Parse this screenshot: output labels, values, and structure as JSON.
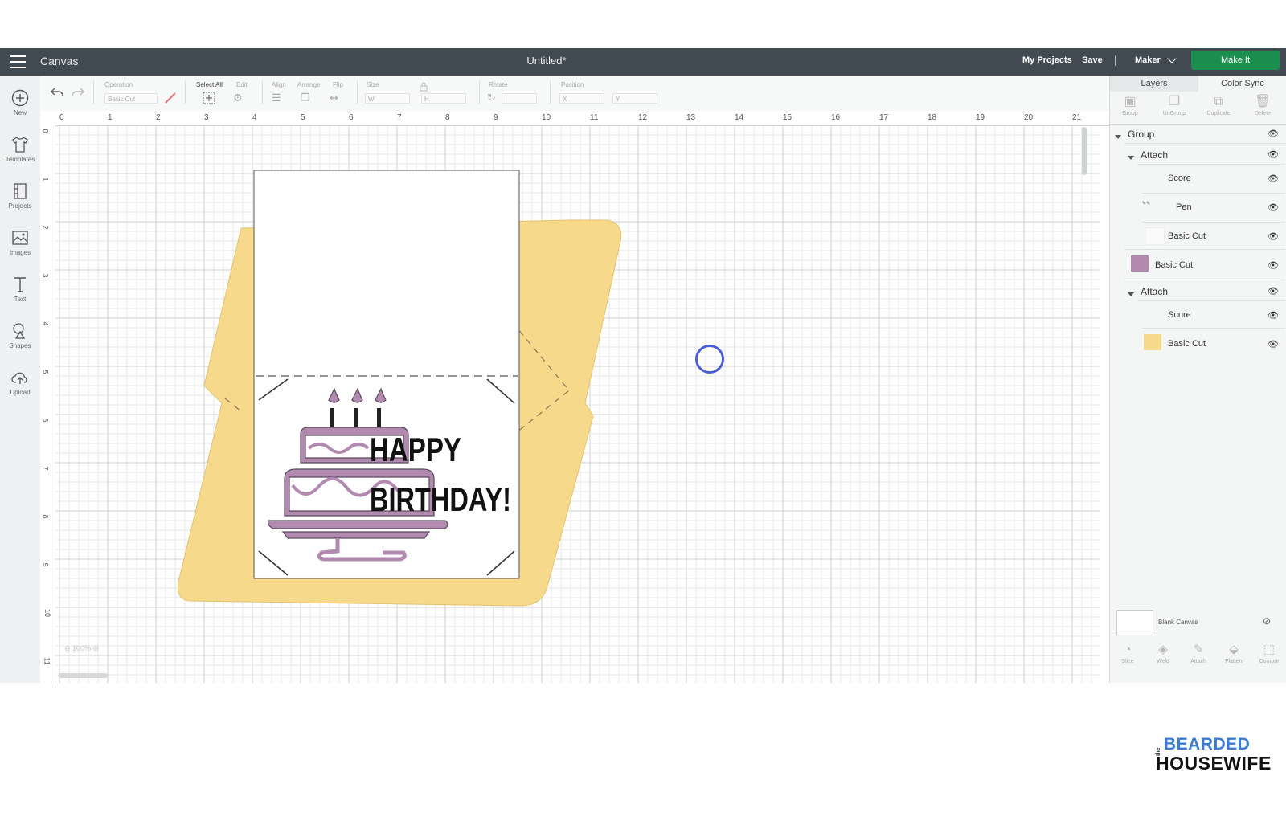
{
  "topbar": {
    "app_name": "Canvas",
    "doc_title": "Untitled*",
    "my_projects": "My Projects",
    "save": "Save",
    "separator": "|",
    "machine": "Maker",
    "make_it": "Make It"
  },
  "sidebar": {
    "items": [
      {
        "label": "New",
        "icon": "plus-circle-icon"
      },
      {
        "label": "Templates",
        "icon": "tshirt-icon"
      },
      {
        "label": "Projects",
        "icon": "projects-icon"
      },
      {
        "label": "Images",
        "icon": "images-icon"
      },
      {
        "label": "Text",
        "icon": "text-icon"
      },
      {
        "label": "Shapes",
        "icon": "shapes-icon"
      },
      {
        "label": "Upload",
        "icon": "upload-icon"
      }
    ]
  },
  "toolbar": {
    "operation_label": "Operation",
    "operation_value": "Basic Cut",
    "select_all": "Select All",
    "edit": "Edit",
    "align": "Align",
    "arrange": "Arrange",
    "flip": "Flip",
    "size": "Size",
    "w": "W",
    "h": "H",
    "rotate": "Rotate",
    "position": "Position",
    "x": "X",
    "y": "Y"
  },
  "canvas": {
    "ruler_top": [
      "0",
      "1",
      "2",
      "3",
      "4",
      "5",
      "6",
      "7",
      "8",
      "9",
      "10",
      "11",
      "12",
      "13",
      "14",
      "15",
      "16",
      "17",
      "18",
      "19",
      "20",
      "21"
    ],
    "ruler_left": [
      "0",
      "1",
      "2",
      "3",
      "4",
      "5",
      "6",
      "7",
      "8",
      "9",
      "10",
      "11"
    ],
    "zoom": "100%",
    "card_text_1": "HAPPY",
    "card_text_2": "BIRTHDAY!",
    "colors": {
      "envelope": "#f7d98b",
      "cake": "#b28ab0",
      "grid_minor": "#e6e6e6",
      "grid_major": "#cfcfcf"
    }
  },
  "rpanel": {
    "tabs": [
      "Layers",
      "Color Sync"
    ],
    "tools": [
      "Group",
      "UnGroup",
      "Duplicate",
      "Delete"
    ],
    "layers": [
      {
        "name": "Group",
        "level": 0,
        "expander": true
      },
      {
        "name": "Attach",
        "level": 1,
        "expander": true
      },
      {
        "name": "Score",
        "level": 2
      },
      {
        "name": "Pen",
        "level": 2
      },
      {
        "name": "Basic Cut",
        "level": 2
      },
      {
        "name": "Basic Cut",
        "level": 1,
        "swatch": "#b28ab0"
      },
      {
        "name": "Attach",
        "level": 1,
        "expander": true
      },
      {
        "name": "Score",
        "level": 2
      },
      {
        "name": "Basic Cut",
        "level": 2,
        "swatch": "#f7d98b"
      }
    ],
    "blank_canvas": "Blank Canvas",
    "bottom_tools": [
      "Slice",
      "Weld",
      "Attach",
      "Flatten",
      "Contour"
    ]
  },
  "watermark": {
    "the": "the",
    "line1": "BEARDED",
    "line2": "HOUSEWIFE"
  }
}
